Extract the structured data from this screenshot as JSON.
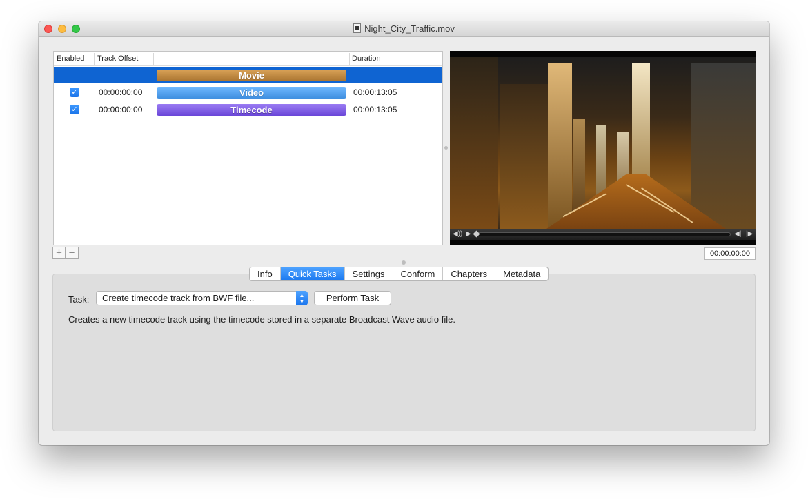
{
  "window": {
    "title": "Night_City_Traffic.mov"
  },
  "table": {
    "headers": {
      "enabled": "Enabled",
      "track_offset": "Track Offset",
      "name": "",
      "duration": "Duration"
    },
    "rows": [
      {
        "name": "Movie",
        "offset": "",
        "duration": "",
        "enabled": null,
        "selected": true,
        "color": "#c48a3e"
      },
      {
        "name": "Video",
        "offset": "00:00:00:00",
        "duration": "00:00:13:05",
        "enabled": true,
        "selected": false,
        "color": "#4a9bf0"
      },
      {
        "name": "Timecode",
        "offset": "00:00:00:00",
        "duration": "00:00:13:05",
        "enabled": true,
        "selected": false,
        "color": "#7a5be6"
      }
    ],
    "add_label": "+",
    "remove_label": "−"
  },
  "player": {
    "time": "00:00:00:00",
    "position": 0.0,
    "icons": [
      "volume-icon",
      "play-icon",
      "step-back-icon",
      "step-forward-icon"
    ]
  },
  "tabs": [
    {
      "label": "Info",
      "active": false
    },
    {
      "label": "Quick Tasks",
      "active": true
    },
    {
      "label": "Settings",
      "active": false
    },
    {
      "label": "Conform",
      "active": false
    },
    {
      "label": "Chapters",
      "active": false
    },
    {
      "label": "Metadata",
      "active": false
    }
  ],
  "quick_tasks": {
    "task_label": "Task:",
    "task_value": "Create timecode track from BWF file...",
    "perform_label": "Perform Task",
    "description": "Creates a new timecode track using the timecode stored in a separate Broadcast Wave audio file."
  },
  "colors": {
    "accent": "#1b79f0",
    "selection": "#0f64d2"
  }
}
